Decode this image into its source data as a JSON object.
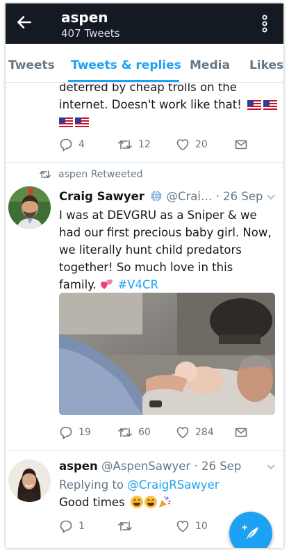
{
  "header": {
    "title": "aspen",
    "subtitle": "407 Tweets",
    "back_icon": "arrow-left-icon",
    "more_icon": "vertical-dots-icon",
    "bg_color": "#131a21"
  },
  "tabs": [
    {
      "label": "Tweets",
      "active": false
    },
    {
      "label": "Tweets & replies",
      "active": true
    },
    {
      "label": "Media",
      "active": false
    },
    {
      "label": "Likes",
      "active": false
    }
  ],
  "accent_color": "#1da1f2",
  "tweets": [
    {
      "text_line1": "deterred by cheap trolls on the",
      "text_line2": "internet. Doesn't work like that!",
      "flags": [
        "us-flag",
        "us-flag",
        "us-flag",
        "us-flag"
      ],
      "replies": "4",
      "retweets": "12",
      "likes": "20"
    },
    {
      "retweeted_by": "aspen Retweeted",
      "author_name": "Craig Sawyer",
      "author_handle": "@Crai…",
      "time": "· 26 Sep",
      "text_lines": [
        "I was at DEVGRU as a Sniper & we",
        "had our first precious baby girl. Now,",
        "we literally hunt child predators",
        "together! So much love in this"
      ],
      "text_last_prefix": "family.",
      "hashtag": "#V4CR",
      "replies": "19",
      "retweets": "60",
      "likes": "284"
    },
    {
      "author_name": "aspen",
      "author_handle": "@AspenSawyer",
      "time": "· 26 Sep",
      "replying_prefix": "Replying to",
      "replying_to": "@CraigRSawyer",
      "text": "Good times",
      "replies": "1",
      "retweets": "",
      "likes": "10"
    }
  ],
  "fab_icon": "compose-icon"
}
